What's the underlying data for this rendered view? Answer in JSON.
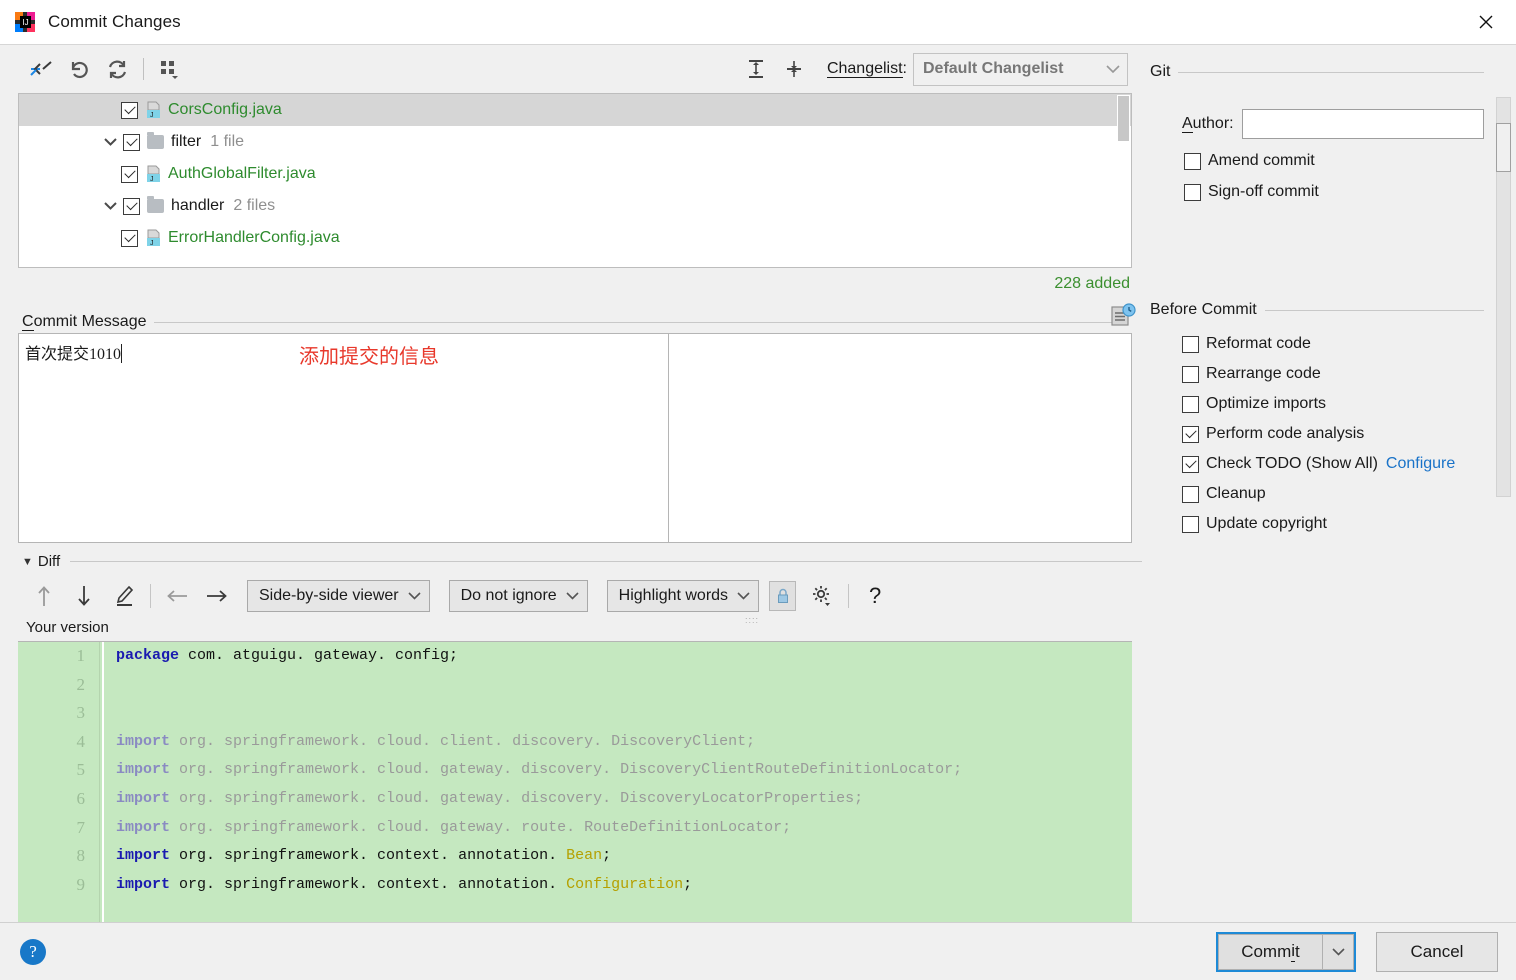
{
  "window": {
    "title": "Commit Changes",
    "logo_icon": "intellij-idea-logo",
    "close_icon": "close-icon"
  },
  "toolbar": {
    "icons": [
      {
        "name": "collapse-selection-icon",
        "label": ""
      },
      {
        "name": "rollback-icon",
        "label": ""
      },
      {
        "name": "refresh-icon",
        "label": ""
      },
      {
        "name": "group-by-icon",
        "label": ""
      },
      {
        "name": "expand-all-icon",
        "label": ""
      },
      {
        "name": "collapse-all-icon",
        "label": ""
      }
    ],
    "changelist_label": "Changelist:",
    "changelist_value": "Default Changelist"
  },
  "file_tree": {
    "rows": [
      {
        "name": "CorsConfig.java",
        "type": "file",
        "checked": true,
        "selected": true,
        "indent": 1,
        "count": ""
      },
      {
        "name": "filter",
        "type": "folder",
        "checked": true,
        "selected": false,
        "indent": 0,
        "count": "1 file"
      },
      {
        "name": "AuthGlobalFilter.java",
        "type": "file",
        "checked": true,
        "selected": false,
        "indent": 1,
        "count": ""
      },
      {
        "name": "handler",
        "type": "folder",
        "checked": true,
        "selected": false,
        "indent": 0,
        "count": "2 files"
      },
      {
        "name": "ErrorHandlerConfig.java",
        "type": "file",
        "checked": true,
        "selected": false,
        "indent": 1,
        "count": ""
      }
    ],
    "added_count": "228 added"
  },
  "commit_message": {
    "legend": "Commit Message",
    "value": "首次提交1010",
    "annotation": "添加提交的信息",
    "annotation_color": "#e8382b",
    "history_icon": "commit-message-history-icon"
  },
  "diff": {
    "legend": "Diff",
    "collapse_icon": "triangle-down-icon",
    "toolbar": {
      "prev_icon": "arrow-up-icon",
      "next_icon": "arrow-down-icon",
      "edit_icon": "pencil-icon",
      "left_icon": "arrow-left-icon",
      "right_icon": "arrow-right-icon",
      "viewer_mode": "Side-by-side viewer",
      "ignore_mode": "Do not ignore",
      "highlight_mode": "Highlight words",
      "lock_icon": "lock-icon",
      "settings_icon": "gear-icon",
      "help_icon": "question-mark-icon"
    },
    "pane_label": "Your version",
    "line_numbers": [
      "1",
      "2",
      "3",
      "4",
      "5",
      "6",
      "7",
      "8",
      "9"
    ],
    "code_lines": [
      {
        "kw": "package",
        "rest": " com. atguigu. gateway. config;",
        "dim": false,
        "ann": ""
      },
      {
        "kw": "",
        "rest": "",
        "dim": false,
        "ann": ""
      },
      {
        "kw": "",
        "rest": "",
        "dim": false,
        "ann": ""
      },
      {
        "kw": "import",
        "rest": " org. springframework. cloud. client. discovery. DiscoveryClient;",
        "dim": true,
        "ann": ""
      },
      {
        "kw": "import",
        "rest": " org. springframework. cloud. gateway. discovery. DiscoveryClientRouteDefinitionLocator;",
        "dim": true,
        "ann": ""
      },
      {
        "kw": "import",
        "rest": " org. springframework. cloud. gateway. discovery. DiscoveryLocatorProperties;",
        "dim": true,
        "ann": ""
      },
      {
        "kw": "import",
        "rest": " org. springframework. cloud. gateway. route. RouteDefinitionLocator;",
        "dim": true,
        "ann": ""
      },
      {
        "kw": "import",
        "rest": " org. springframework. context. annotation. ",
        "dim": false,
        "ann": "Bean",
        "tail": ";"
      },
      {
        "kw": "import",
        "rest": " org. springframework. context. annotation. ",
        "dim": false,
        "ann": "Configuration",
        "tail": ";"
      }
    ],
    "diff_bg_color": "#c5e8c0",
    "marker_color": "#f0b400"
  },
  "right_panel": {
    "git": {
      "legend": "Git",
      "author_label": "Author:",
      "author_value": "",
      "checkboxes": [
        {
          "label": "Amend commit",
          "checked": false
        },
        {
          "label": "Sign-off commit",
          "checked": false
        }
      ]
    },
    "before_commit": {
      "legend": "Before Commit",
      "checkboxes": [
        {
          "label": "Reformat code",
          "checked": false,
          "link": ""
        },
        {
          "label": "Rearrange code",
          "checked": false,
          "link": ""
        },
        {
          "label": "Optimize imports",
          "checked": false,
          "link": ""
        },
        {
          "label": "Perform code analysis",
          "checked": true,
          "link": ""
        },
        {
          "label": "Check TODO (Show All)",
          "checked": true,
          "link": "Configure"
        },
        {
          "label": "Cleanup",
          "checked": false,
          "link": ""
        },
        {
          "label": "Update copyright",
          "checked": false,
          "link": ""
        }
      ]
    }
  },
  "footer": {
    "help_icon": "help-icon",
    "help_label": "?",
    "commit_label": "Commit",
    "commit_dropdown_icon": "chevron-down-icon",
    "cancel_label": "Cancel",
    "accent_color": "#1e8ad6"
  }
}
